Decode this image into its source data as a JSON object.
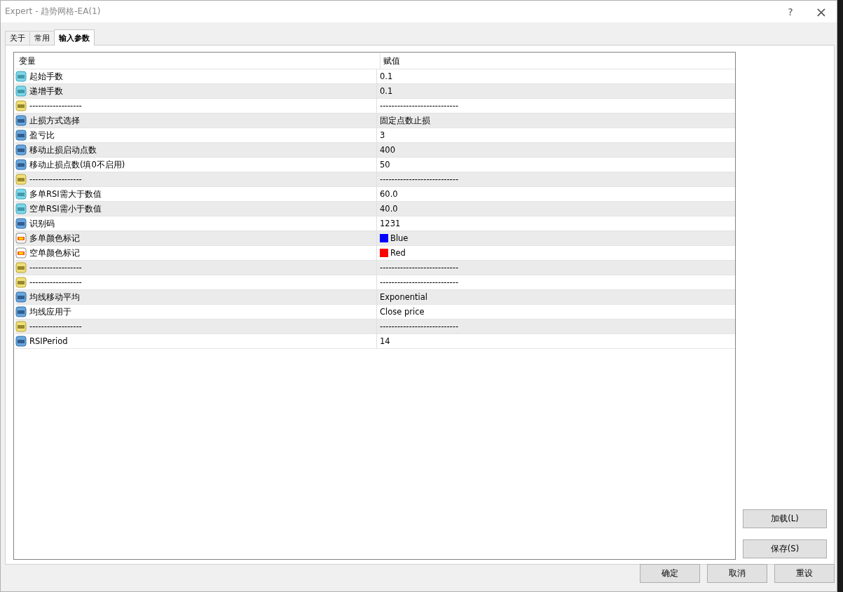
{
  "window": {
    "title": "Expert - 趋势网格-EA(1)",
    "help": "?",
    "close": "×"
  },
  "tabs": [
    {
      "label": "关于",
      "selected": false
    },
    {
      "label": "常用",
      "selected": false
    },
    {
      "label": "输入参数",
      "selected": true
    }
  ],
  "table": {
    "columns": [
      "变量",
      "赋值"
    ],
    "rows": [
      {
        "kind": "double",
        "name": "起始手数",
        "value": "0.1"
      },
      {
        "kind": "double",
        "name": "递增手数",
        "value": "0.1"
      },
      {
        "kind": "string",
        "name": "------------------",
        "value": "---------------------------"
      },
      {
        "kind": "int",
        "name": "止损方式选择",
        "value": "固定点数止损"
      },
      {
        "kind": "int",
        "name": "盈亏比",
        "value": "3"
      },
      {
        "kind": "int",
        "name": "移动止损启动点数",
        "value": "400"
      },
      {
        "kind": "int",
        "name": "移动止损点数(填0不启用)",
        "value": "50"
      },
      {
        "kind": "string",
        "name": "------------------",
        "value": "---------------------------"
      },
      {
        "kind": "double",
        "name": "多单RSI需大于数值",
        "value": "60.0"
      },
      {
        "kind": "double",
        "name": "空单RSI需小于数值",
        "value": "40.0"
      },
      {
        "kind": "int",
        "name": "识别码",
        "value": "1231"
      },
      {
        "kind": "color",
        "name": "多单颜色标记",
        "value": "Blue",
        "color": "#0000ff"
      },
      {
        "kind": "color",
        "name": "空单颜色标记",
        "value": "Red",
        "color": "#ff0000"
      },
      {
        "kind": "string",
        "name": "------------------",
        "value": "---------------------------"
      },
      {
        "kind": "string",
        "name": "------------------",
        "value": "---------------------------"
      },
      {
        "kind": "int",
        "name": "均线移动平均",
        "value": "Exponential"
      },
      {
        "kind": "int",
        "name": "均线应用于",
        "value": "Close price"
      },
      {
        "kind": "string",
        "name": "------------------",
        "value": "---------------------------"
      },
      {
        "kind": "int",
        "name": "RSIPeriod",
        "value": "14"
      }
    ]
  },
  "side_buttons": [
    "加载(L)",
    "保存(S)"
  ],
  "bottom_buttons": [
    "确定",
    "取消",
    "重设"
  ]
}
